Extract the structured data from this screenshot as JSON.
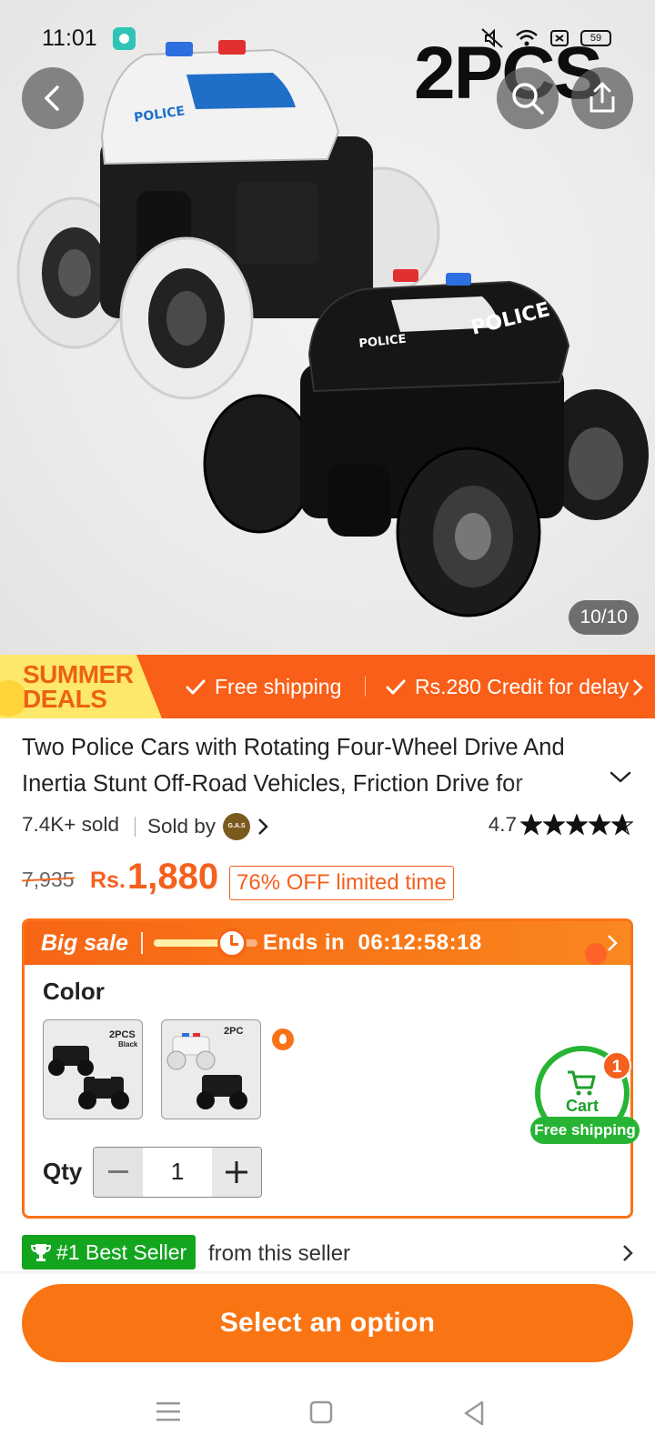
{
  "status_bar": {
    "time": "11:01",
    "battery": "59"
  },
  "hero": {
    "overlay_label": "2PCS",
    "page_indicator": "10/10"
  },
  "promo_strip": {
    "badge_line1": "SUMMER",
    "badge_line2": "DEALS",
    "item1": "Free shipping",
    "item2": "Rs.280 Credit for delay"
  },
  "product": {
    "title": "Two Police Cars with Rotating Four-Wheel Drive And Inertia Stunt Off-Road Vehicles, Friction Drive for",
    "sold": "7.4K+ sold",
    "sold_by": "Sold by",
    "seller_logo_text": "G.A.S",
    "rating": "4.7",
    "stars": 4.7,
    "old_price": "7,935",
    "currency": "Rs.",
    "price": "1,880",
    "discount": "76% OFF limited time"
  },
  "sale": {
    "label": "Big sale",
    "ends_label": "Ends in",
    "countdown": "06:12:58:18",
    "progress": 0.78
  },
  "options": {
    "color_label": "Color",
    "swatches": [
      {
        "text": "2PCS",
        "subtext": "Black"
      },
      {
        "text": "2PC"
      }
    ],
    "qty_label": "Qty",
    "qty_value": "1"
  },
  "cart": {
    "label": "Cart",
    "count": "1",
    "free_shipping": "Free shipping"
  },
  "best_seller": {
    "badge": "#1 Best Seller",
    "text": "from this seller"
  },
  "cta": {
    "label": "Select an option"
  },
  "colors": {
    "accent": "#f97413",
    "green": "#27b434",
    "price": "#f4601d"
  }
}
